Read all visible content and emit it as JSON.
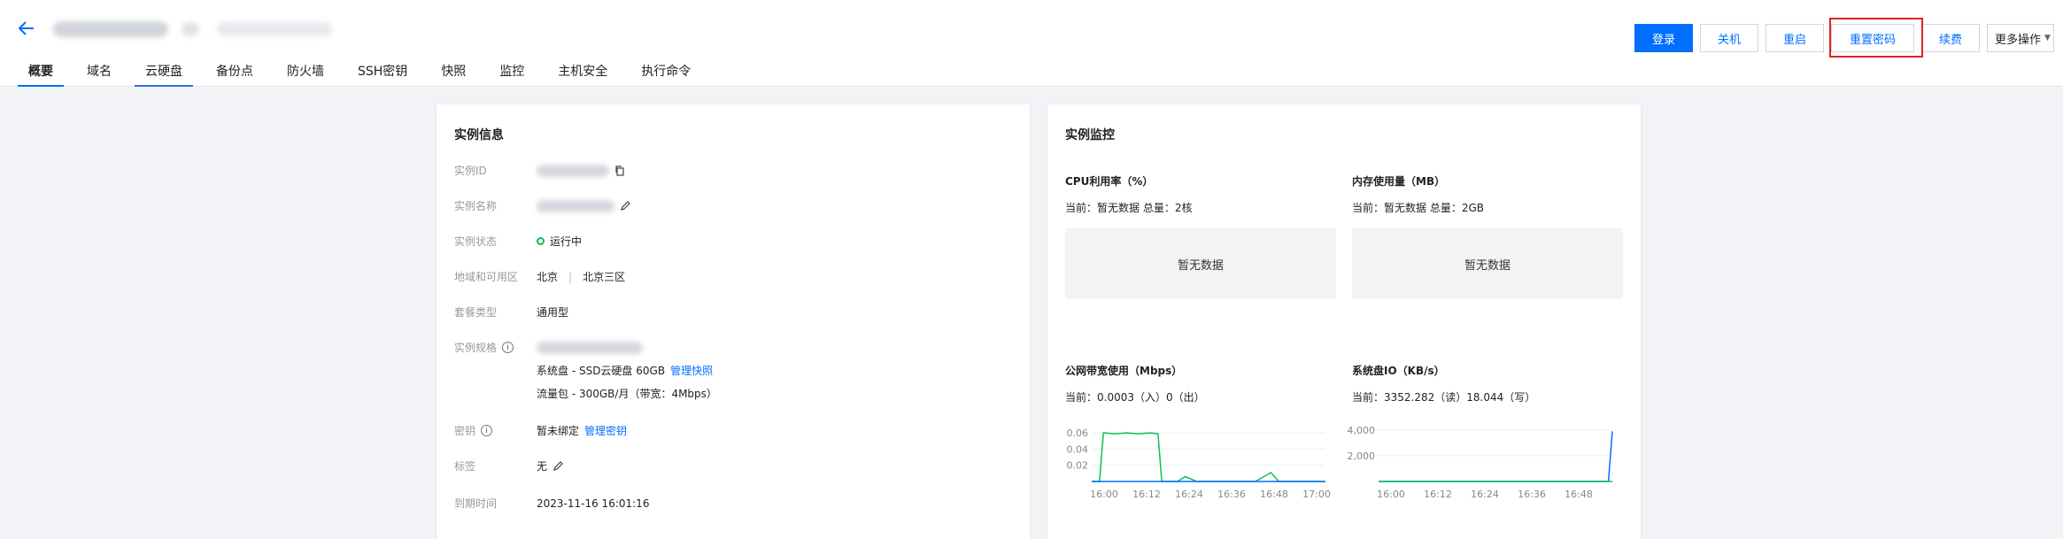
{
  "header": {
    "tabs": [
      "概要",
      "域名",
      "云硬盘",
      "备份点",
      "防火墙",
      "SSH密钥",
      "快照",
      "监控",
      "主机安全",
      "执行命令"
    ],
    "actions": {
      "login": "登录",
      "shutdown": "关机",
      "restart": "重启",
      "reset_password": "重置密码",
      "renew": "续费",
      "more": "更多操作"
    }
  },
  "instance_info": {
    "title": "实例信息",
    "id_label": "实例ID",
    "name_label": "实例名称",
    "status_label": "实例状态",
    "status_value": "运行中",
    "region_label": "地域和可用区",
    "region_value": "北京",
    "zone_value": "北京三区",
    "package_label": "套餐类型",
    "package_value": "通用型",
    "spec_label": "实例规格",
    "system_disk": "系统盘 - SSD云硬盘 60GB",
    "manage_snapshot": "管理快照",
    "traffic": "流量包 - 300GB/月（带宽：4Mbps）",
    "key_label": "密钥",
    "key_value": "暂未绑定",
    "manage_key": "管理密钥",
    "tag_label": "标签",
    "tag_value": "无",
    "expire_label": "到期时间",
    "expire_value": "2023-11-16 16:01:16"
  },
  "monitor": {
    "title": "实例监控",
    "cpu_title": "CPU利用率（%）",
    "cpu_sub": "当前：暂无数据 总量：2核",
    "cpu_nodata": "暂无数据",
    "mem_title": "内存使用量（MB）",
    "mem_sub": "当前：暂无数据 总量：2GB",
    "mem_nodata": "暂无数据",
    "net_title": "公网带宽使用（Mbps）",
    "net_sub": "当前：0.0003（入）0（出）",
    "disk_title": "系统盘IO（KB/s）",
    "disk_sub": "当前：3352.282（读）18.044（写）"
  },
  "chart_data": [
    {
      "type": "line",
      "title": "公网带宽使用（Mbps）",
      "x_ticks": [
        "16:00",
        "16:12",
        "16:24",
        "16:36",
        "16:48",
        "17:00"
      ],
      "y_ticks": [
        "0.02",
        "0.04",
        "0.06"
      ],
      "ylim": [
        0,
        0.07
      ],
      "series": [
        {
          "color": "#0abf5b",
          "x": [
            0,
            2,
            3,
            6,
            9,
            12,
            15,
            17,
            18,
            19,
            22,
            24,
            27,
            30,
            36,
            42,
            46,
            48,
            50,
            52,
            55,
            60
          ],
          "y": [
            0,
            0,
            0.06,
            0.059,
            0.06,
            0.059,
            0.06,
            0.059,
            0,
            0,
            0,
            0.006,
            0,
            0,
            0,
            0,
            0.011,
            0,
            0,
            0,
            0,
            0
          ]
        },
        {
          "color": "#006eff",
          "x": [
            0,
            60
          ],
          "y": [
            0,
            0
          ]
        }
      ]
    },
    {
      "type": "line",
      "title": "系统盘IO（KB/s）",
      "x_ticks": [
        "16:00",
        "16:12",
        "16:24",
        "16:36",
        "16:48"
      ],
      "y_ticks": [
        "2,000",
        "4,000"
      ],
      "ylim": [
        0,
        4400
      ],
      "series": [
        {
          "color": "#006eff",
          "x": [
            0,
            20,
            40,
            58,
            59,
            60
          ],
          "y": [
            0,
            0,
            0,
            0,
            20,
            3900
          ]
        },
        {
          "color": "#0abf5b",
          "x": [
            0,
            60
          ],
          "y": [
            0,
            0
          ]
        }
      ]
    }
  ]
}
